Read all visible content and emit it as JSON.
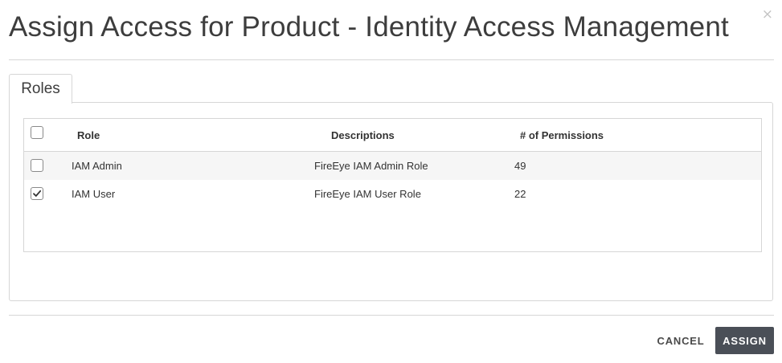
{
  "dialog": {
    "title": "Assign Access for Product - Identity Access Management",
    "close_symbol": "×",
    "close_icon": "close-icon"
  },
  "tabs": [
    {
      "label": "Roles",
      "active": true
    }
  ],
  "table": {
    "columns": [
      "Role",
      "Descriptions",
      "# of Permissions"
    ],
    "select_all_checked": false,
    "rows": [
      {
        "role": "IAM Admin",
        "description": "FireEye IAM Admin Role",
        "permissions": "49",
        "checked": false
      },
      {
        "role": "IAM User",
        "description": "FireEye IAM User Role",
        "permissions": "22",
        "checked": true
      }
    ]
  },
  "footer": {
    "cancel_label": "CANCEL",
    "assign_label": "ASSIGN"
  },
  "colors": {
    "primary_button": "#4a4f57",
    "border": "#d6d6d6",
    "row_stripe": "#f6f6f6"
  }
}
